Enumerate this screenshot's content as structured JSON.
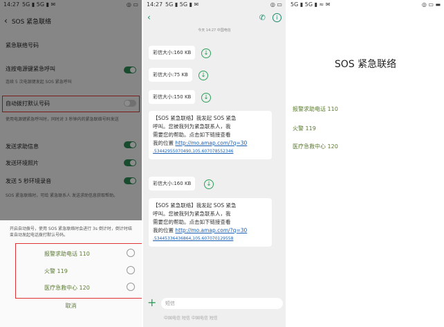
{
  "panel1": {
    "status_time": "14:27",
    "status_signal": "5G ▮ 5G ▮ ✉",
    "status_right": "◎ ▭",
    "back_icon": "back-arrow",
    "title": "SOS 紧急联络",
    "rows": [
      {
        "label": "紧急联络号码"
      },
      {
        "label": "连按电源键紧急呼叫",
        "sub": "连续 5 次电源键发起 SOS 紧急呼叫",
        "toggle": "on"
      },
      {
        "label": "自动拨打默认号码",
        "toggle": "off"
      },
      {
        "label": "发送求助信息",
        "sub": "使用电源键紧急呼叫时，同时对 3 秒钟内的紧急联络号码发送",
        "toggle": "on"
      },
      {
        "label": "发送环境照片",
        "toggle": "on"
      },
      {
        "label": "发送 5 秒环境录音",
        "toggle": "on"
      }
    ],
    "footer_note": "SOS 紧急联络时，可给 紧急联系人 发送求助信息获取帮助。",
    "sheet_desc": "开启自动拨号，使用 SOS 紧急联络时会进行 3s 倒计时，倒计时结束自动发起电话拨打默认号码。",
    "options": [
      {
        "label": "报警求助电话 110"
      },
      {
        "label": "火警 119"
      },
      {
        "label": "医疗急救中心 120"
      }
    ],
    "cancel": "取消"
  },
  "panel2": {
    "status_time": "14:27",
    "status_signal": "5G ▮ 5G ▮ ✉",
    "status_right": "◎ ▭",
    "contact": "",
    "time_label": "今天 14:27  中国电信",
    "files": [
      "彩信大小:160 KB",
      "彩信大小:75 KB",
      "彩信大小:150 KB",
      "彩信大小:160 KB"
    ],
    "msg1_lines": [
      "【SOS 紧急联络】我发起 SOS 紧急",
      "呼叫。您被我列为紧急联系人，我",
      "需要您的帮助。点击如下链接查看",
      "我的位置"
    ],
    "msg1_link": "http://mo.amap.com/?q=30",
    "msg1_link2": ".53442955070490,105.607078552346",
    "msg2_lines": [
      "【SOS 紧急联络】我发起 SOS 紧急",
      "呼叫。您被我列为紧急联系人，我",
      "需要您的帮助。点击如下链接查看",
      "我的位置"
    ],
    "msg2_link": "http://mo.amap.com/?q=30",
    "msg2_link2": ".53445336436864,105.607070129558",
    "input_placeholder": "短信",
    "bottom_hint": "中国电信 短信    中国电信 短信"
  },
  "panel3": {
    "status_signal": "5G ▮ 5G ▮ ≈ ✉",
    "status_right": "◎ ▭ ▬",
    "title": "SOS 紧急联络",
    "items": [
      "报警求助电话 110",
      "火警 119",
      "医疗急救中心 120"
    ]
  },
  "colors": {
    "accent": "#2aa05a",
    "red_highlight": "#d33333",
    "link": "#1a5fb4"
  }
}
